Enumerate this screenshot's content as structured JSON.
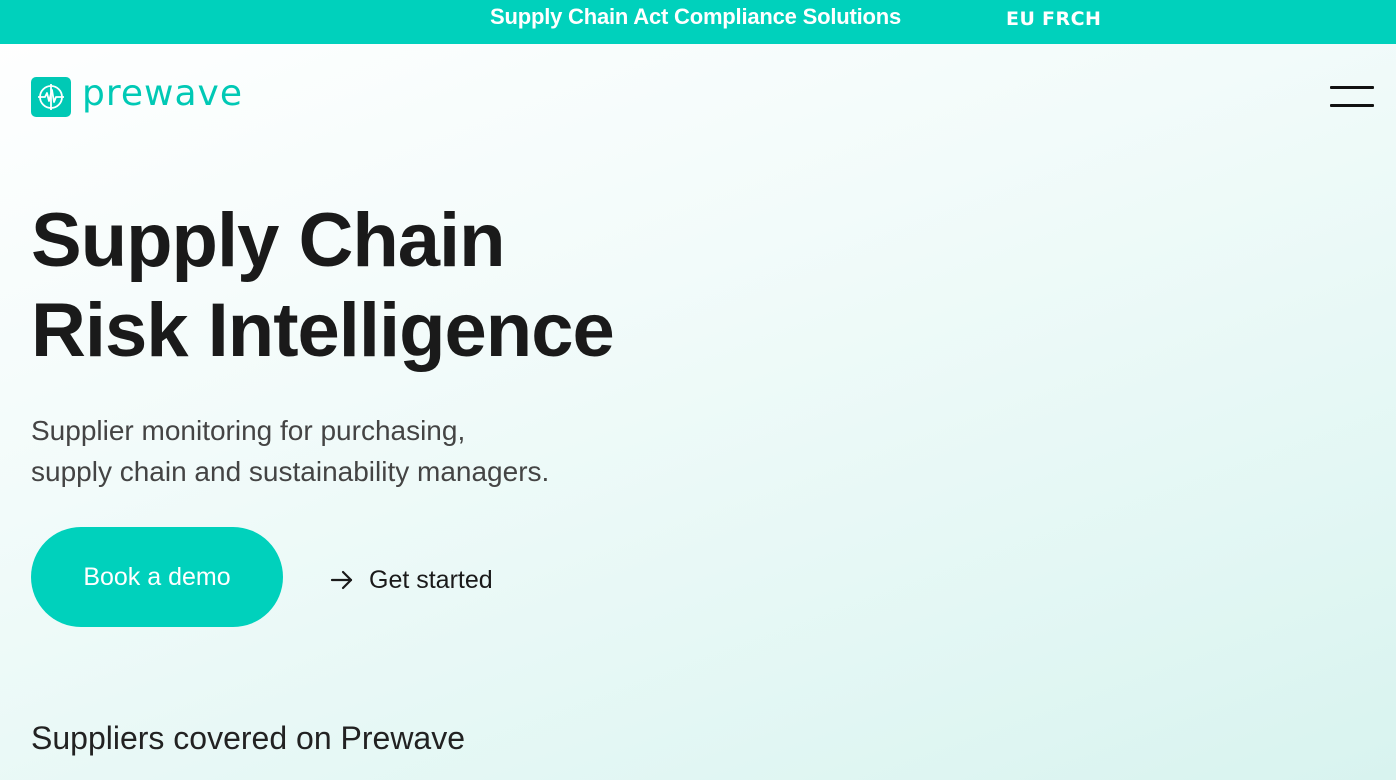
{
  "topbar": {
    "link_text": "Supply Chain Act Compliance Solutions",
    "regions": [
      "EU",
      "FRCH"
    ],
    "background_color": "#00d1bc"
  },
  "header": {
    "logo_text": "prewave",
    "logo_icon": "heartbeat-globe-icon",
    "menu_icon": "hamburger-menu-icon"
  },
  "hero": {
    "headline_line1": "Supply Chain",
    "headline_line2": "Risk Intelligence",
    "subtitle_line1": "Supplier monitoring for purchasing,",
    "subtitle_line2": "supply chain and sustainability managers.",
    "primary_cta": "Book a demo",
    "secondary_cta": "Get started",
    "secondary_cta_icon": "arrow-right-icon"
  },
  "section": {
    "heading": "Suppliers covered on Prewave"
  },
  "colors": {
    "accent": "#00d1bc",
    "text_dark": "#1a1a1a",
    "text_muted": "#444444"
  }
}
